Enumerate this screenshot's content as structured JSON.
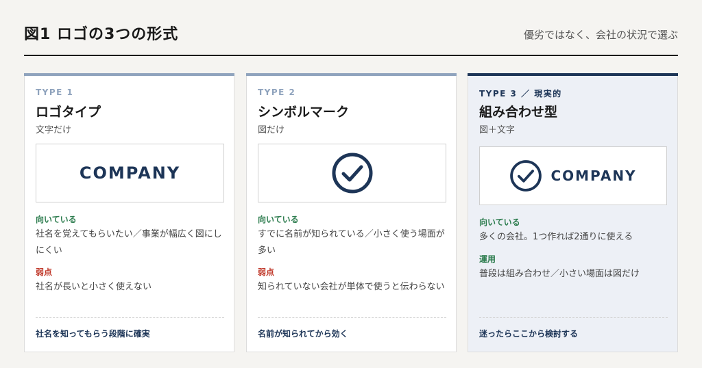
{
  "header": {
    "title": "図1  ロゴの3つの形式",
    "subtitle": "優劣ではなく、会社の状況で選ぶ"
  },
  "colors": {
    "accent_light": "#8fa3bd",
    "accent_dark": "#1d3557",
    "good": "#2e7d4f",
    "weak": "#c0392b"
  },
  "cards": [
    {
      "type_label": "TYPE 1",
      "title": "ロゴタイプ",
      "subtitle": "文字だけ",
      "logo_text": "COMPANY",
      "good_label": "向いている",
      "good_text": "社名を覚えてもらいたい／事業が幅広く図にしにくい",
      "weak_label": "弱点",
      "weak_text": "社名が長いと小さく使えない",
      "footer": "社名を知ってもらう段階に確実"
    },
    {
      "type_label": "TYPE 2",
      "title": "シンボルマーク",
      "subtitle": "図だけ",
      "logo_icon": "check-circle-icon",
      "good_label": "向いている",
      "good_text": "すでに名前が知られている／小さく使う場面が多い",
      "weak_label": "弱点",
      "weak_text": "知られていない会社が単体で使うと伝わらない",
      "footer": "名前が知られてから効く"
    },
    {
      "type_label": "TYPE 3 ／ 現実的",
      "title": "組み合わせ型",
      "subtitle": "図＋文字",
      "logo_icon": "check-circle-icon",
      "logo_text": "COMPANY",
      "good_label": "向いている",
      "good_text": "多くの会社。1つ作れば2通りに使える",
      "use_label": "運用",
      "use_text": "普段は組み合わせ／小さい場面は図だけ",
      "footer": "迷ったらここから検討する"
    }
  ]
}
